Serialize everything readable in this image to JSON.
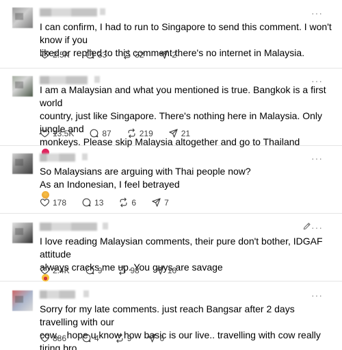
{
  "comments": [
    {
      "lines": [
        "I can confirm, I had to run to Singapore to send this comment. I won't know if you",
        "liked or replied to this comment there's no internet in Malaysia."
      ],
      "likes": "2.5K",
      "replies": "33",
      "reposts": "32",
      "shares": "2"
    },
    {
      "lines": [
        "I am a Malaysian and what you mentioned is true. Bangkok is a first world",
        "country, just like Singapore. There's nothing here in Malaysia. Only jungle and",
        "monkeys. Please skip Malaysia altogether and go to Thailand"
      ],
      "emoji": "heart",
      "likes": "13.5K",
      "replies": "87",
      "reposts": "219",
      "shares": "21"
    },
    {
      "lines": [
        "So Malaysians are arguing with Thai people now?",
        "As an Indonesian, I feel betrayed"
      ],
      "emoji": "smirk-face",
      "likes": "178",
      "replies": "13",
      "reposts": "6",
      "shares": "7"
    },
    {
      "lines": [
        "I love reading Malaysian comments, their pure don't bother, IDGAF attitude",
        "always cracks me up. You guys are savage"
      ],
      "emoji": "laughing-face",
      "likes": "2.4K",
      "replies": "9",
      "reposts": "98",
      "shares": "16"
    },
    {
      "lines": [
        "Sorry for my late comments. just reach Bangsar after 2 days travelling with our",
        "cow... hope u know how basic is our live.. travelling with cow really tiring bro..."
      ],
      "likes": "886",
      "replies": "4",
      "reposts": "9",
      "shares": "6"
    }
  ],
  "icons": {
    "like": "heart-outline-icon",
    "reply": "speech-bubble-icon",
    "repost": "repost-arrows-icon",
    "share": "send-triangle-icon",
    "more": "more-dots-icon",
    "edit": "pencil-icon"
  },
  "colors": {
    "text": "#000000",
    "meta": "#424242",
    "divider": "#e5e5e5",
    "heart_emoji": "#e0245e"
  }
}
